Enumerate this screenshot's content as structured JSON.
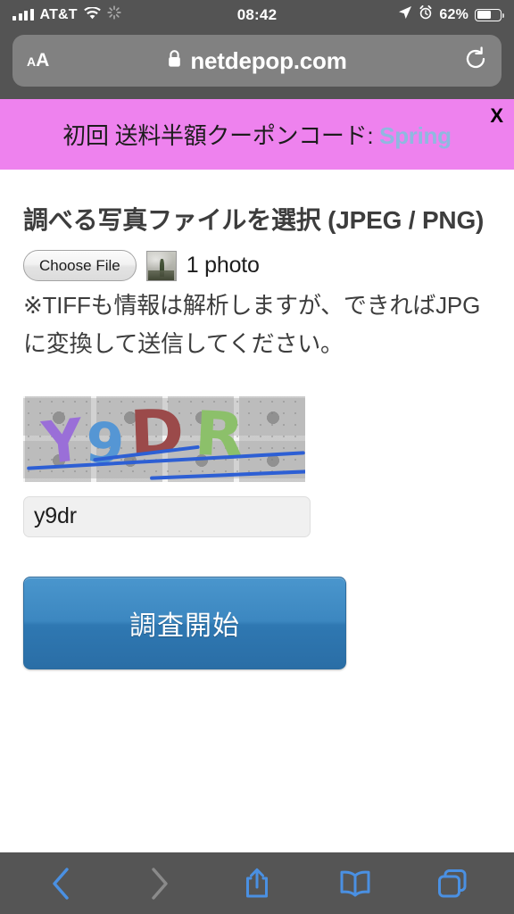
{
  "status_bar": {
    "carrier": "AT&T",
    "time": "08:42",
    "battery_percent": "62%",
    "battery_level": 62,
    "signal_icon": "signal-bars-icon",
    "wifi_icon": "wifi-icon",
    "spinner_icon": "activity-spinner-icon",
    "location_icon": "location-arrow-icon",
    "alarm_icon": "alarm-clock-icon",
    "battery_icon": "battery-icon"
  },
  "browser": {
    "text_size_label": "AA",
    "lock_icon": "padlock-icon",
    "url": "netdepop.com",
    "reload_icon": "reload-icon"
  },
  "banner": {
    "text_prefix": "初回 送料半額クーポンコード: ",
    "code": "Spring",
    "close_label": "X",
    "background_color": "#ee82ee",
    "code_color": "#8fb8e0"
  },
  "page": {
    "title": "調べる写真ファイルを選択 (JPEG / PNG)",
    "choose_file_label": "Choose File",
    "photo_count": "1 photo",
    "thumbnail_icon": "photo-thumbnail",
    "note": "※TIFFも情報は解析しますが、できればJPGに変換して送信してください。",
    "captcha": {
      "letters": [
        "Y",
        "9",
        "D",
        "R"
      ],
      "colors": [
        "#9a6fd8",
        "#5596d4",
        "#9b4a4a",
        "#8cc06a"
      ],
      "input_value": "y9dr",
      "input_placeholder": ""
    },
    "submit_label": "調査開始",
    "submit_color": "#3c87c0"
  },
  "toolbar": {
    "back_label": "back",
    "forward_label": "forward",
    "share_label": "share",
    "bookmarks_label": "bookmarks",
    "tabs_label": "tabs",
    "active_color": "#4a90e2",
    "disabled_color": "#8a8a8a"
  }
}
